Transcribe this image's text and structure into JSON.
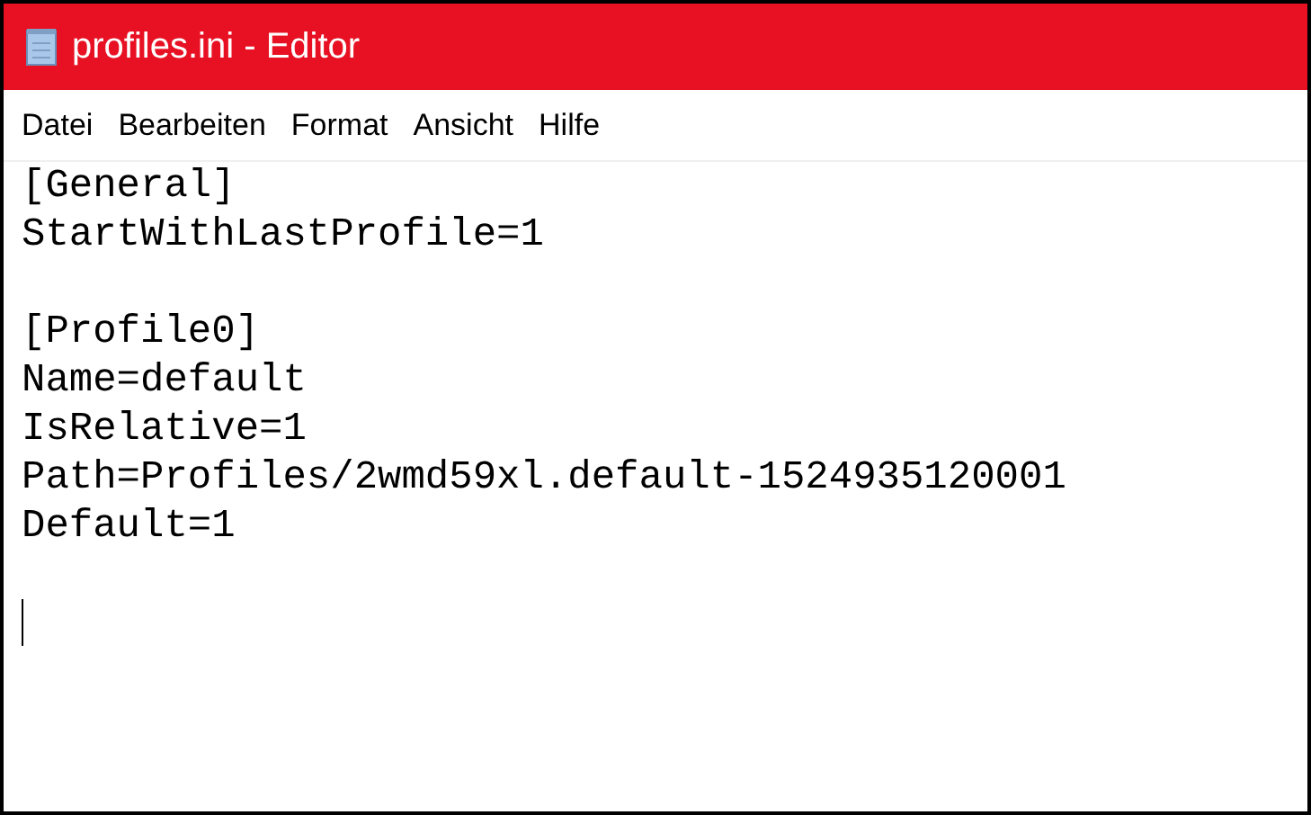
{
  "window": {
    "title": "profiles.ini - Editor"
  },
  "menu": [
    "Datei",
    "Bearbeiten",
    "Format",
    "Ansicht",
    "Hilfe"
  ],
  "document": {
    "sections": [
      {
        "lines": [
          "[General]",
          "StartWithLastProfile=1"
        ]
      },
      {
        "lines": [
          "[Profile0]",
          "Name=default",
          "IsRelative=1",
          "Path=Profiles/2wmd59xl.default-1524935120001",
          "Default=1"
        ]
      }
    ]
  }
}
